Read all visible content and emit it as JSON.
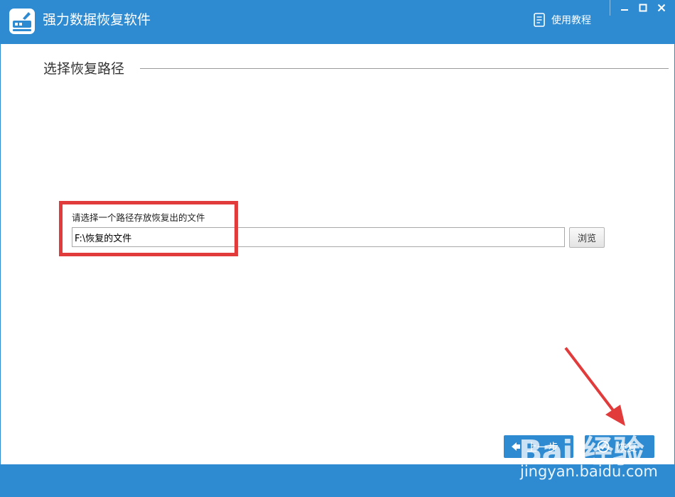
{
  "app": {
    "title": "强力数据恢复软件",
    "tutorial_label": "使用教程"
  },
  "section": {
    "title": "选择恢复路径"
  },
  "path_form": {
    "label": "请选择一个路径存放恢复出的文件",
    "value": "F:\\恢复的文件",
    "browse_label": "浏览"
  },
  "footer_buttons": {
    "prev_label": "上一步",
    "recover_label": "恢复"
  },
  "watermark": {
    "logo_text": "Bai 经验",
    "url": "jingyan.baidu.com"
  },
  "colors": {
    "accent": "#2f8bd1",
    "highlight": "#e23b3b",
    "arrow": "#e23b3b"
  }
}
